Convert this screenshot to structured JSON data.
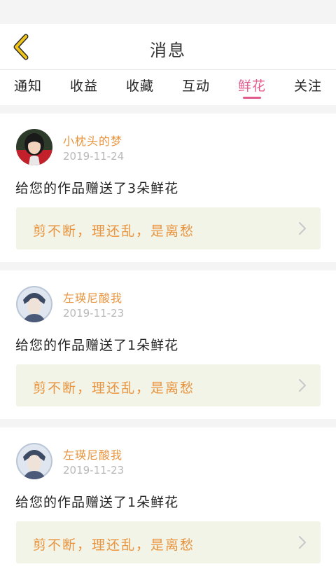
{
  "header": {
    "title": "消息"
  },
  "tabs": [
    {
      "label": "通知",
      "active": false
    },
    {
      "label": "收益",
      "active": false
    },
    {
      "label": "收藏",
      "active": false
    },
    {
      "label": "互动",
      "active": false
    },
    {
      "label": "鲜花",
      "active": true
    },
    {
      "label": "关注",
      "active": false
    }
  ],
  "messages": [
    {
      "username": "小枕头的梦",
      "date": "2019-11-24",
      "text": "给您的作品赠送了3朵鲜花",
      "quote": "剪不断，理还乱，是离愁",
      "avatar": "avatar-girl"
    },
    {
      "username": "左瑛尼酸我",
      "date": "2019-11-23",
      "text": "给您的作品赠送了1朵鲜花",
      "quote": "剪不断，理还乱，是离愁",
      "avatar": "avatar-boy"
    },
    {
      "username": "左瑛尼酸我",
      "date": "2019-11-23",
      "text": "给您的作品赠送了1朵鲜花",
      "quote": "剪不断，理还乱，是离愁",
      "avatar": "avatar-boy"
    }
  ],
  "colors": {
    "accent_tab": "#e05a8c",
    "username": "#e8943f",
    "quote": "#e8943f",
    "quote_bg": "#f3f4e8",
    "back_arrow": "#f0c419"
  },
  "icons": {
    "back": "chevron-left-icon",
    "item_arrow": "chevron-right-icon"
  }
}
